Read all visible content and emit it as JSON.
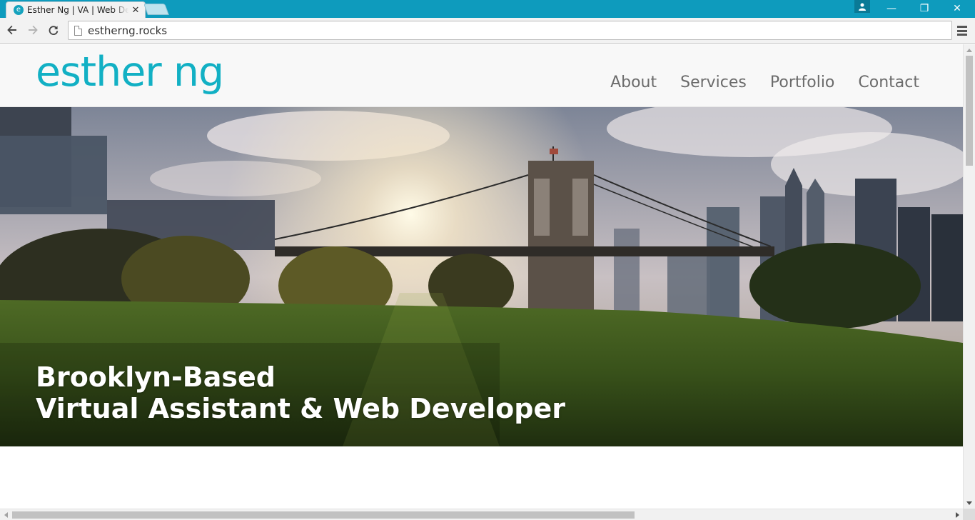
{
  "browser": {
    "tab_title": "Esther Ng | VA | Web Developer",
    "tab_favicon_letter": "e",
    "tab_close": "✕",
    "url": "estherng.rocks",
    "window_controls": {
      "minimize": "—",
      "maximize": "❐",
      "close": "✕"
    }
  },
  "site": {
    "logo": "esther ng",
    "nav": [
      {
        "label": "About"
      },
      {
        "label": "Services"
      },
      {
        "label": "Portfolio"
      },
      {
        "label": "Contact"
      }
    ],
    "hero": {
      "line1": "Brooklyn-Based",
      "line2": "Virtual Assistant & Web Developer"
    }
  },
  "colors": {
    "titlebar": "#0e9bbd",
    "brand": "#12b0c4",
    "nav_text": "#6b6b6b"
  },
  "icons": {
    "back": "arrow-left-icon",
    "forward": "arrow-right-icon",
    "reload": "reload-icon",
    "page": "page-icon",
    "menu": "hamburger-menu-icon",
    "profile": "person-icon"
  }
}
